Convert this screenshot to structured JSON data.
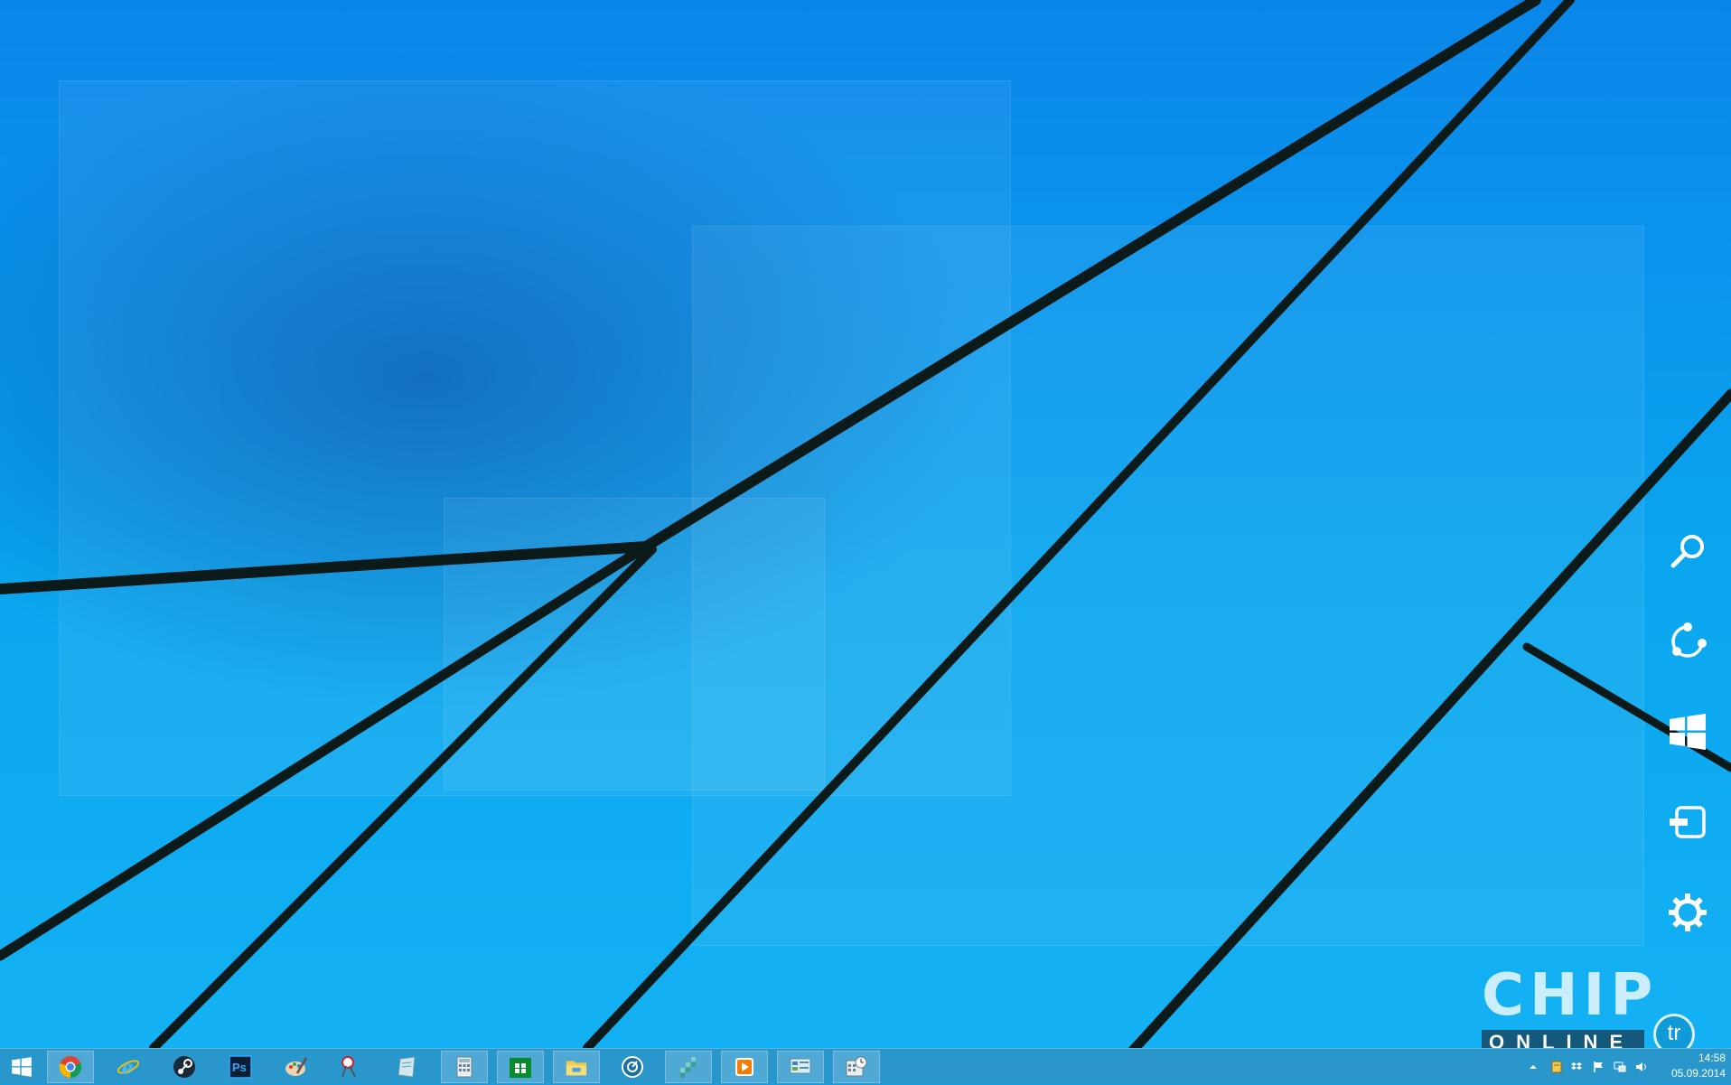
{
  "colors": {
    "wallpaper_top": "#0a86ea",
    "wallpaper_bottom": "#14b1f4",
    "wallpaper_lines": "#0c1a1a",
    "taskbar": "#2c96c8"
  },
  "charms": [
    {
      "id": "search",
      "label": "Search",
      "icon": "search-icon"
    },
    {
      "id": "share",
      "label": "Share",
      "icon": "share-icon"
    },
    {
      "id": "start",
      "label": "Start",
      "icon": "windows-logo-icon"
    },
    {
      "id": "devices",
      "label": "Devices",
      "icon": "devices-icon"
    },
    {
      "id": "settings",
      "label": "Settings",
      "icon": "gear-icon"
    }
  ],
  "watermark": {
    "brand": "CHIP",
    "sub": "ONLINE",
    "badge": "tr"
  },
  "taskbar": {
    "start_icon": "windows-logo-icon",
    "apps": [
      {
        "name": "chrome",
        "icon": "chrome-icon",
        "running": true
      },
      {
        "name": "internet-explorer",
        "icon": "internet-explorer-icon",
        "running": false
      },
      {
        "name": "steam",
        "icon": "steam-icon",
        "running": false
      },
      {
        "name": "photoshop",
        "icon": "photoshop-icon",
        "label": "Ps",
        "running": false
      },
      {
        "name": "paint",
        "icon": "paint-palette-icon",
        "running": false
      },
      {
        "name": "snipping-tool",
        "icon": "snipping-tool-icon",
        "running": false
      },
      {
        "name": "notes",
        "icon": "notepad-icon",
        "running": false
      },
      {
        "name": "calculator",
        "icon": "calculator-icon",
        "running": true
      },
      {
        "name": "store",
        "icon": "store-icon",
        "running": true
      },
      {
        "name": "file-explorer",
        "icon": "folder-icon",
        "running": true
      },
      {
        "name": "speedometer",
        "icon": "speedometer-icon",
        "running": false
      },
      {
        "name": "tiles",
        "icon": "tiles-icon",
        "running": true
      },
      {
        "name": "media-player",
        "icon": "play-icon",
        "running": true
      },
      {
        "name": "control-panel",
        "icon": "control-panel-icon",
        "running": true
      },
      {
        "name": "task-scheduler",
        "icon": "calendar-clock-icon",
        "running": true
      }
    ],
    "tray": [
      {
        "name": "show-hidden",
        "icon": "chevron-up-icon"
      },
      {
        "name": "notes",
        "icon": "note-icon"
      },
      {
        "name": "dropbox",
        "icon": "dropbox-icon"
      },
      {
        "name": "action-center",
        "icon": "flag-icon"
      },
      {
        "name": "network",
        "icon": "network-icon"
      },
      {
        "name": "volume",
        "icon": "speaker-icon"
      }
    ],
    "clock_time": "14:58",
    "clock_date": "05.09.2014"
  }
}
